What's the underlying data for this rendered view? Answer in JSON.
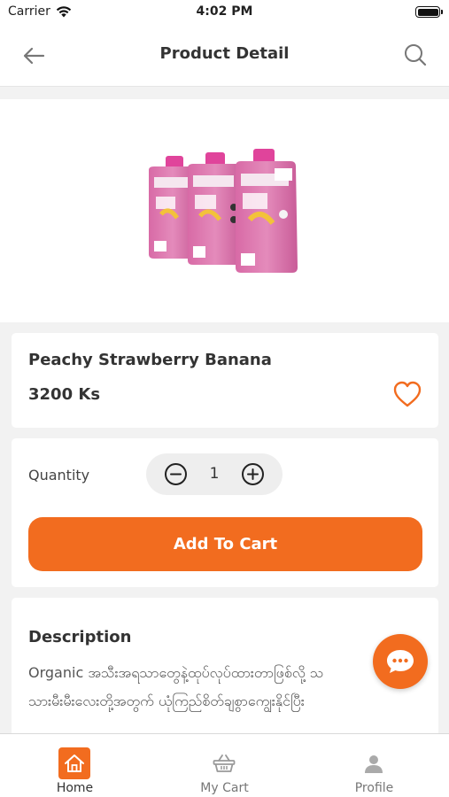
{
  "status_bar": {
    "carrier": "Carrier",
    "time": "4:02 PM"
  },
  "header": {
    "title": "Product Detail",
    "back_icon": "arrow-left-icon",
    "search_icon": "search-icon"
  },
  "product": {
    "name": "Peachy Strawberry Banana",
    "price": "3200 Ks",
    "favorite_icon": "heart-outline-icon"
  },
  "quantity": {
    "label": "Quantity",
    "value": "1"
  },
  "add_to_cart": {
    "label": "Add To Cart"
  },
  "description": {
    "title": "Description",
    "lines": [
      "Organic အသီးအရသာတွေနဲ့ထုပ်လုပ်ထားတာဖြစ်လို့ သ",
      "သားမီးမီးလေးတို့အတွက် ယုံကြည်စိတ်ချစွာကျွေးနိုင်ပြီး"
    ]
  },
  "tabs": [
    {
      "label": "Home",
      "icon": "home-icon",
      "active": true
    },
    {
      "label": "My Cart",
      "icon": "basket-icon",
      "active": false
    },
    {
      "label": "Profile",
      "icon": "user-icon",
      "active": false
    }
  ],
  "colors": {
    "accent": "#f26c1f",
    "background": "#f2f2f2",
    "card": "#ffffff"
  }
}
